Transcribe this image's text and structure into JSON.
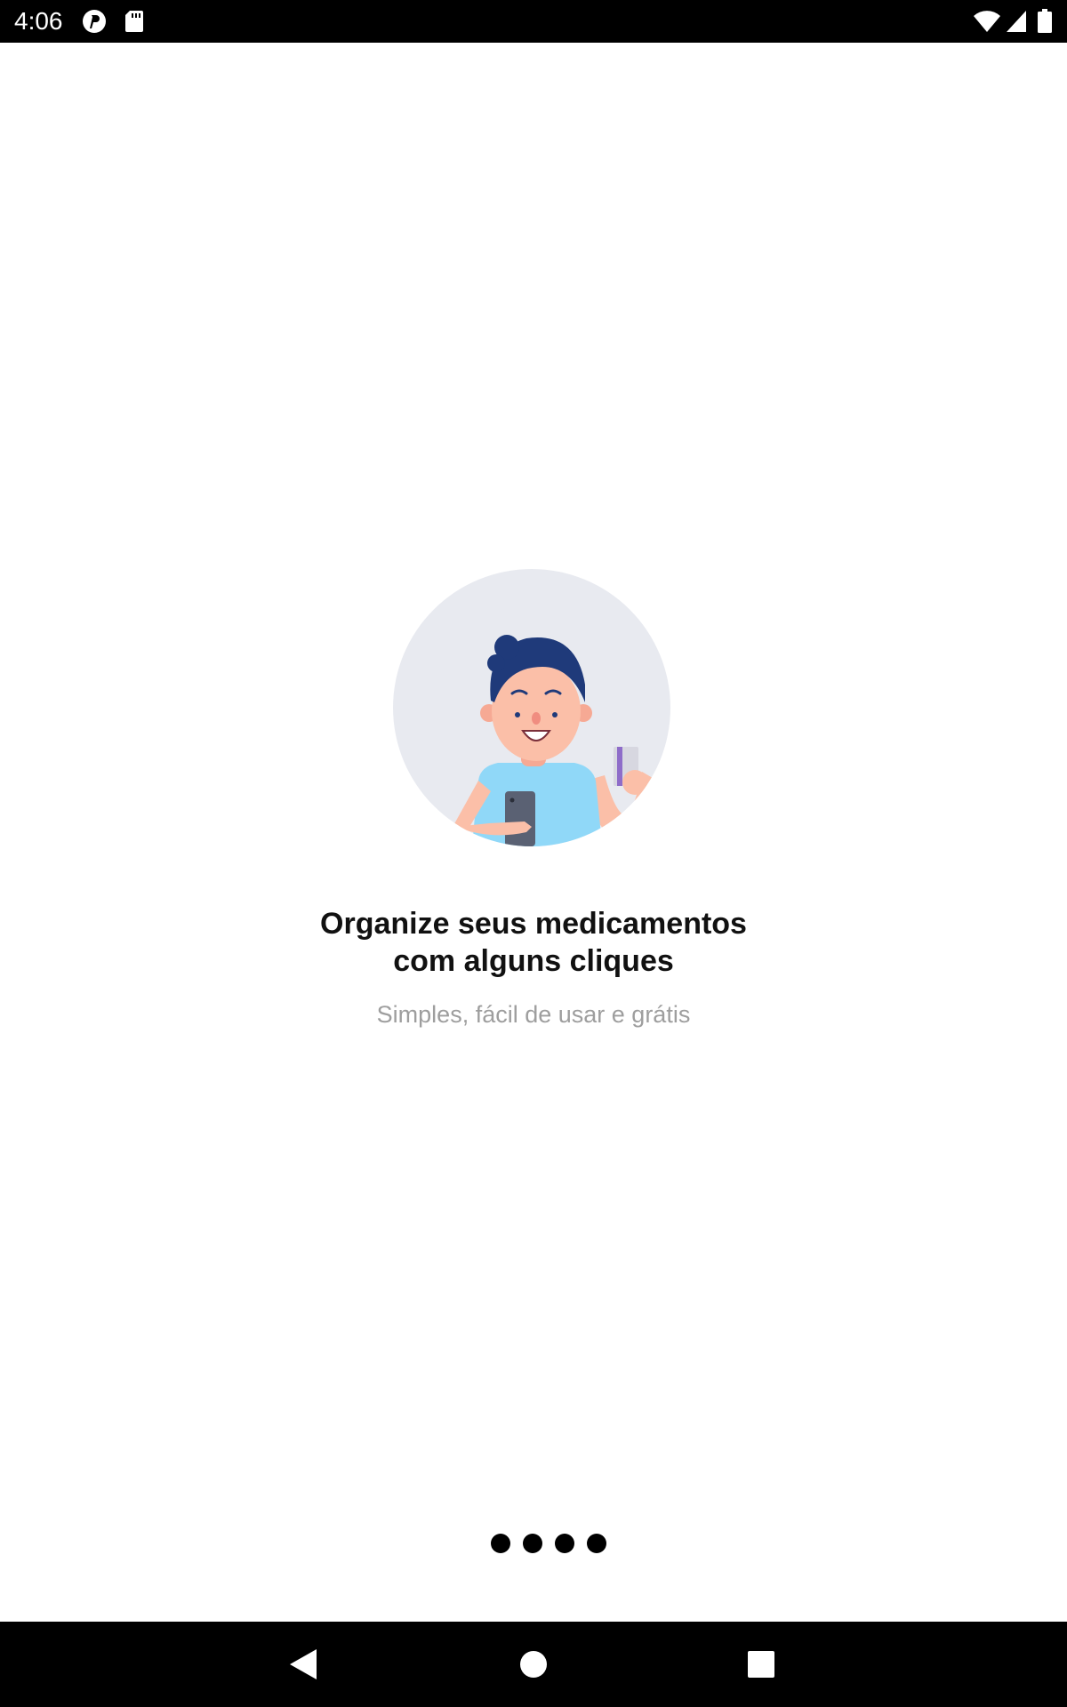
{
  "status_bar": {
    "time": "4:06",
    "left_icons": [
      "pinterest-icon",
      "sd-card-icon"
    ],
    "right_icons": [
      "wifi-icon",
      "cell-signal-icon",
      "battery-icon"
    ]
  },
  "onboarding": {
    "illustration": "person-with-phone-and-card-illustration",
    "title_line1": "Organize seus medicamentos",
    "title_line2": "com alguns cliques",
    "subtitle": "Simples, fácil de usar e grátis",
    "page_indicator": {
      "pages": 4
    }
  },
  "nav_bar": {
    "buttons": [
      "back-icon",
      "home-icon",
      "recents-icon"
    ]
  },
  "colors": {
    "background": "#ffffff",
    "system_bars": "#000000",
    "title": "#111111",
    "subtitle": "#9e9e9e",
    "illustration_bg": "#e8eaf0",
    "hair": "#1f3a7a",
    "shirt": "#90d8f8",
    "skin": "#fbbfa8"
  }
}
